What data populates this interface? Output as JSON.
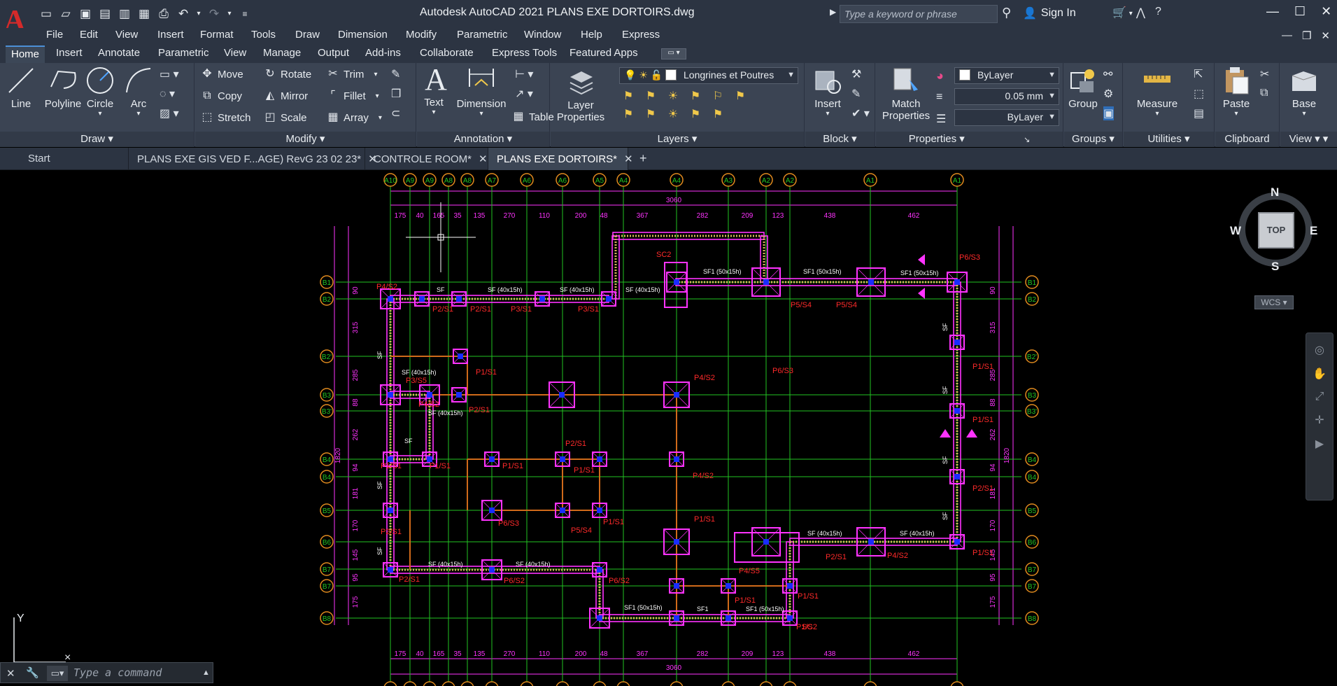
{
  "titlebar": {
    "title": "Autodesk AutoCAD 2021    PLANS EXE DORTOIRS.dwg",
    "search_placeholder": "Type a keyword or phrase",
    "signin": "Sign In"
  },
  "menubar": [
    "File",
    "Edit",
    "View",
    "Insert",
    "Format",
    "Tools",
    "Draw",
    "Dimension",
    "Modify",
    "Parametric",
    "Window",
    "Help",
    "Express"
  ],
  "ribbon_tabs": [
    "Home",
    "Insert",
    "Annotate",
    "Parametric",
    "View",
    "Manage",
    "Output",
    "Add-ins",
    "Collaborate",
    "Express Tools",
    "Featured Apps"
  ],
  "ribbon": {
    "draw": {
      "title": "Draw",
      "line": "Line",
      "polyline": "Polyline",
      "circle": "Circle",
      "arc": "Arc"
    },
    "modify": {
      "title": "Modify",
      "move": "Move",
      "rotate": "Rotate",
      "trim": "Trim",
      "copy": "Copy",
      "mirror": "Mirror",
      "fillet": "Fillet",
      "stretch": "Stretch",
      "scale": "Scale",
      "array": "Array"
    },
    "annotation": {
      "title": "Annotation",
      "text": "Text",
      "dimension": "Dimension",
      "table": "Table"
    },
    "layers": {
      "title": "Layers",
      "layer_properties_1": "Layer",
      "layer_properties_2": "Properties",
      "current_layer": "Longrines et Poutres"
    },
    "block": {
      "title": "Block",
      "insert": "Insert"
    },
    "properties": {
      "title": "Properties",
      "match_1": "Match",
      "match_2": "Properties",
      "color": "ByLayer",
      "lineweight": "0.05 mm",
      "linetype": "ByLayer"
    },
    "groups": {
      "title": "Groups",
      "group": "Group"
    },
    "utilities": {
      "title": "Utilities",
      "measure": "Measure"
    },
    "clipboard": {
      "title": "Clipboard",
      "paste": "Paste"
    },
    "view": {
      "title": "View",
      "base": "Base"
    }
  },
  "doc_tabs": {
    "start": "Start",
    "tab1": "PLANS EXE GIS VED F...AGE) RevG 23 02 23*",
    "tab2": "CONTROLE ROOM*",
    "tab3": "PLANS EXE DORTOIRS*"
  },
  "drawing": {
    "grid_cols": [
      "A10",
      "A9",
      "A9",
      "A8",
      "A8",
      "A7",
      "A6",
      "A6",
      "A5",
      "A4",
      "A4",
      "A3",
      "A2",
      "A2",
      "A1",
      "A1"
    ],
    "grid_rows": [
      "B1",
      "B2",
      "B2'",
      "B3",
      "B3'",
      "B4",
      "B4",
      "B5",
      "B6",
      "B7",
      "B7",
      "B8"
    ],
    "top_dims": [
      "175",
      "40",
      "165",
      "35",
      "135",
      "270",
      "110",
      "200",
      "48",
      "367",
      "282",
      "209",
      "123",
      "438",
      "462"
    ],
    "total_dim": "3060",
    "left_dims": [
      "90",
      "315",
      "285",
      "88",
      "262",
      "94",
      "181",
      "170",
      "145",
      "95",
      "175"
    ],
    "side_total": "1820",
    "footings": [
      "P4/S2",
      "P2/S1",
      "P2/S1",
      "P3/S1",
      "P3/S1",
      "SC2",
      "P5/S4",
      "P5/S4",
      "P6/S3",
      "P1/S1",
      "P3/S5",
      "P4/S2",
      "P2/S1",
      "P4/S2",
      "P6/S3",
      "P1/S1",
      "P1/S1",
      "P1/S1",
      "P1/S1",
      "P1/S1",
      "P1/S1",
      "P2/S1",
      "P4/S2",
      "P2/S1",
      "P2/S1",
      "P6/S3",
      "P5/S4",
      "P1/S1",
      "P1/S1",
      "P4/S2",
      "P2/S1",
      "P1/S1",
      "P2/S1",
      "P6/S2",
      "P6/S2",
      "P4/S5",
      "P1/S1",
      "P1/S1",
      "P1/S2",
      "SC"
    ],
    "beam_labels": [
      "SF",
      "SF (40x15h)",
      "SF (40x15h)",
      "SF (40x15h)",
      "SF1 (50x15h)",
      "SF1 (50x15h)",
      "SF1 (50x15h)",
      "SF (40x15h)",
      "SF (40x15h)",
      "SF (40x15h)",
      "SF (40x15h)",
      "SF1 (50x15h)",
      "SF1",
      "SF1 (50x15h)",
      "SF (40x15h)",
      "SF (40x15h)",
      "SF"
    ]
  },
  "viewcube": {
    "n": "N",
    "s": "S",
    "e": "E",
    "w": "W",
    "face": "TOP",
    "wcs": "WCS"
  },
  "ucs": {
    "y": "Y"
  },
  "command": {
    "placeholder": "Type a command"
  }
}
